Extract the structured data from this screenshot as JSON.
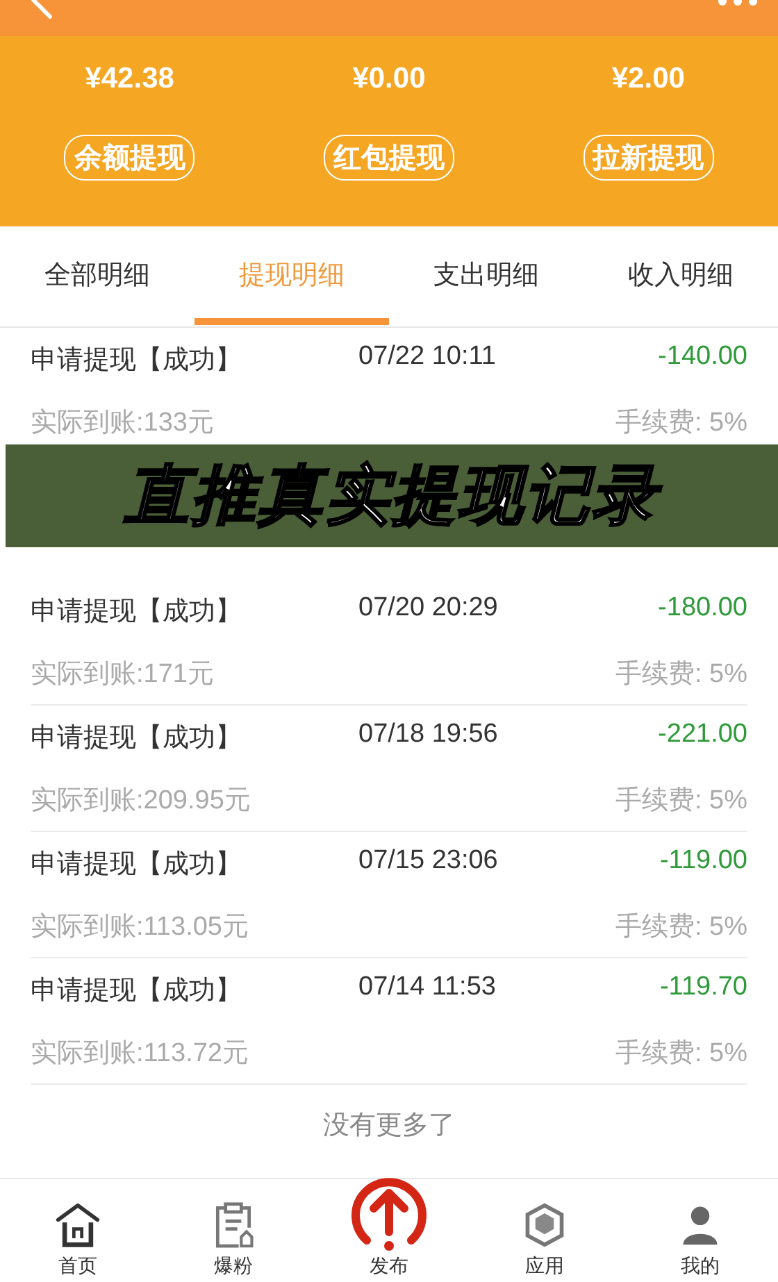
{
  "balances": [
    {
      "amount": "¥42.38"
    },
    {
      "amount": "¥0.00"
    },
    {
      "amount": "¥2.00"
    }
  ],
  "actions": [
    "余额提现",
    "红包提现",
    "拉新提现"
  ],
  "tabs": [
    {
      "label": "全部明细",
      "selected": false
    },
    {
      "label": "提现明细",
      "selected": true
    },
    {
      "label": "支出明细",
      "selected": false
    },
    {
      "label": "收入明细",
      "selected": false
    }
  ],
  "records": [
    {
      "kind": "record",
      "title": "申请提现【成功】",
      "time": "07/22 10:11",
      "amount": "-140.00",
      "received": "实际到账:133元",
      "fee": "手续费: 5%"
    },
    {
      "kind": "banner",
      "text": "直推真实提现记录"
    },
    {
      "kind": "record",
      "title": "申请提现【成功】",
      "time": "07/20 20:29",
      "amount": "-180.00",
      "received": "实际到账:171元",
      "fee": "手续费: 5%"
    },
    {
      "kind": "record",
      "title": "申请提现【成功】",
      "time": "07/18 19:56",
      "amount": "-221.00",
      "received": "实际到账:209.95元",
      "fee": "手续费: 5%"
    },
    {
      "kind": "record",
      "title": "申请提现【成功】",
      "time": "07/15 23:06",
      "amount": "-119.00",
      "received": "实际到账:113.05元",
      "fee": "手续费: 5%"
    },
    {
      "kind": "record",
      "title": "申请提现【成功】",
      "time": "07/14 11:53",
      "amount": "-119.70",
      "received": "实际到账:113.72元",
      "fee": "手续费: 5%"
    }
  ],
  "end_note": "没有更多了",
  "nav": [
    {
      "kind": "home",
      "label": "首页"
    },
    {
      "kind": "clipboard",
      "label": "爆粉"
    },
    {
      "kind": "publish",
      "label": "发布"
    },
    {
      "kind": "box",
      "label": "应用"
    },
    {
      "kind": "person",
      "label": "我的"
    }
  ]
}
